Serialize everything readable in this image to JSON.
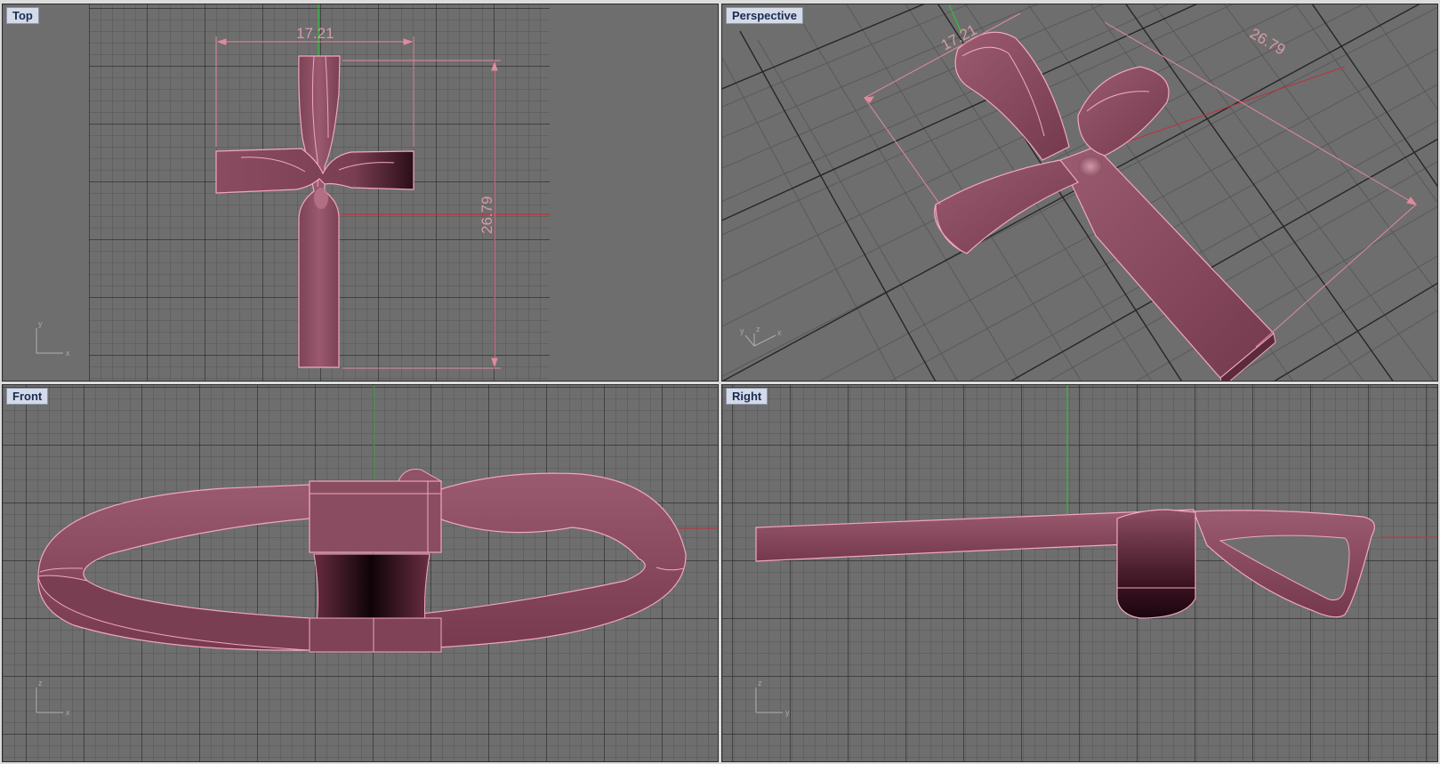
{
  "viewports": {
    "top": {
      "label": "Top"
    },
    "perspective": {
      "label": "Perspective"
    },
    "front": {
      "label": "Front"
    },
    "right": {
      "label": "Right"
    }
  },
  "dimensions": {
    "width": "17.21",
    "height": "26.79"
  },
  "axes": {
    "top": {
      "x": "x",
      "y": "y"
    },
    "perspective": {
      "x": "x",
      "y": "y",
      "z": "z"
    },
    "front": {
      "x": "x",
      "z": "z"
    },
    "right": {
      "y": "y",
      "z": "z"
    }
  },
  "colors": {
    "viewport_bg": "#6e6e6e",
    "grid_minor": "#595959",
    "grid_major": "#262626",
    "object_fill": "#8c4f62",
    "object_edge": "#f2a7bd",
    "dimension": "#e08a9e",
    "axis_green": "#2fbf3a",
    "axis_red": "#c0303a"
  }
}
